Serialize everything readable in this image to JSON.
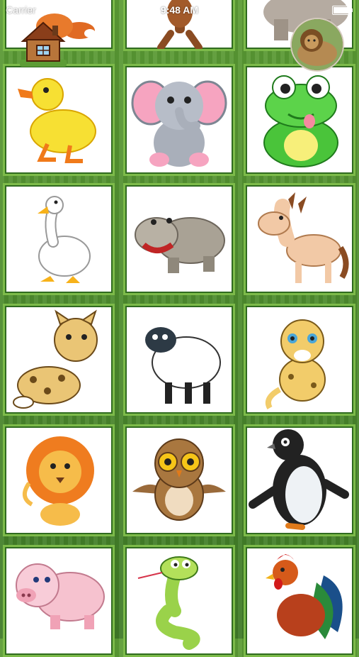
{
  "status_bar": {
    "carrier": "Carrier",
    "time": "9:48 AM",
    "wifi_icon": "wifi-icon",
    "battery_icon": "battery-icon"
  },
  "navigation": {
    "home_icon": "house-icon",
    "lion_icon": "lion-photo-icon"
  },
  "animals": [
    "fox",
    "monkey",
    "rhino",
    "duck",
    "elephant",
    "frog",
    "goose",
    "hippo",
    "horse",
    "leopard",
    "sheep",
    "cheetah",
    "lion",
    "owl",
    "penguin",
    "pig",
    "snake",
    "rooster"
  ]
}
